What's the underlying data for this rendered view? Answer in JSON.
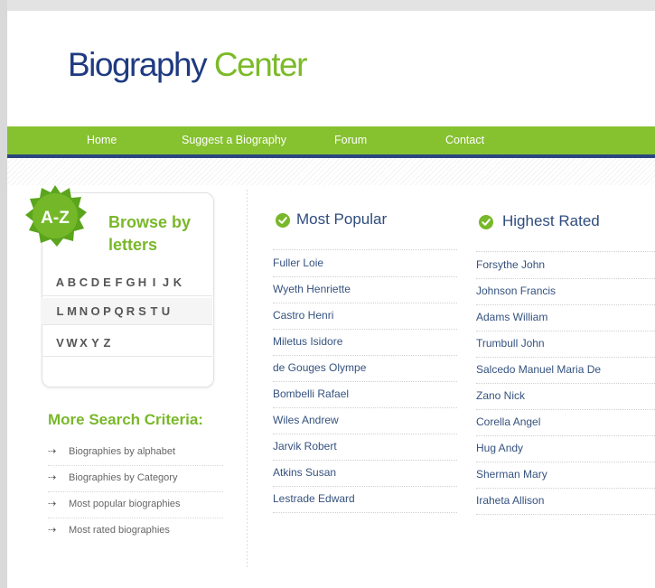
{
  "site": {
    "logo_part1": "Biography",
    "logo_part2": "Center"
  },
  "nav": {
    "items": [
      "Home",
      "Suggest a Biography",
      "Forum",
      "Contact"
    ]
  },
  "browse": {
    "badge": "A-Z",
    "title": "Browse by letters",
    "rows": [
      [
        "A",
        "B",
        "C",
        "D",
        "E",
        "F",
        "G",
        "H",
        "I",
        "J",
        "K"
      ],
      [
        "L",
        "M",
        "N",
        "O",
        "P",
        "Q",
        "R",
        "S",
        "T",
        "U"
      ],
      [
        "V",
        "W",
        "X",
        "Y",
        "Z"
      ]
    ]
  },
  "more": {
    "title": "More Search Criteria:",
    "arrow": "⇢",
    "items": [
      "Biographies by alphabet",
      "Biographies by Category",
      "Most popular biographies",
      "Most rated biographies"
    ]
  },
  "popular": {
    "title": "Most Popular",
    "items": [
      "Fuller Loie",
      "Wyeth Henriette",
      "Castro Henri",
      "Miletus Isidore",
      "de Gouges Olympe",
      "Bombelli Rafael",
      "Wiles Andrew",
      "Jarvik Robert",
      "Atkins Susan",
      "Lestrade Edward"
    ]
  },
  "rated": {
    "title": "Highest Rated",
    "items": [
      "Forsythe John",
      "Johnson Francis",
      "Adams William",
      "Trumbull John",
      "Salcedo Manuel Maria De",
      "Zano Nick",
      "Corella Angel",
      "Hug Andy",
      "Sherman Mary",
      "Iraheta Allison"
    ]
  },
  "colors": {
    "brand_blue": "#1e3a80",
    "brand_green": "#7cba28",
    "nav_green": "#86c12f",
    "nav_border": "#2b467e",
    "link_blue": "#35527f"
  }
}
